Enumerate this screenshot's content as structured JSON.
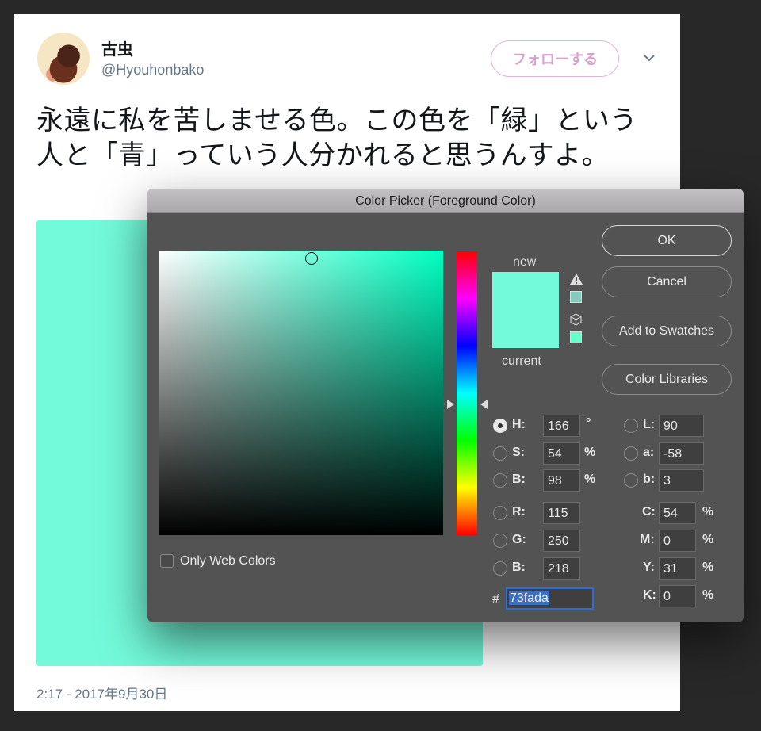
{
  "tweet": {
    "display_name": "古虫",
    "handle": "@Hyouhonbako",
    "follow_label": "フォローする",
    "text": "永遠に私を苦しませる色。この色を「緑」という人と「青」っていう人分かれると思うんすよ。",
    "media_color": "#73fada",
    "timestamp": "2:17 - 2017年9月30日",
    "icons": {
      "menu": "chevron-down-icon",
      "avatar": "avatar-image"
    }
  },
  "dialog": {
    "title": "Color Picker (Foreground Color)",
    "swatch_new_label": "new",
    "swatch_current_label": "current",
    "new_color": "#73fada",
    "current_color": "#73fada",
    "gamut_warning_color": "#86c9bd",
    "web_safe_color": "#66ffcc",
    "buttons": {
      "ok": "OK",
      "cancel": "Cancel",
      "add_swatches": "Add to Swatches",
      "color_libraries": "Color Libraries"
    },
    "only_web_colors_label": "Only Web Colors",
    "only_web_colors_checked": false,
    "hsb": [
      {
        "label": "H:",
        "value": "166",
        "unit": "°",
        "selected": true
      },
      {
        "label": "S:",
        "value": "54",
        "unit": "%",
        "selected": false
      },
      {
        "label": "B:",
        "value": "98",
        "unit": "%",
        "selected": false
      }
    ],
    "rgb": [
      {
        "label": "R:",
        "value": "115"
      },
      {
        "label": "G:",
        "value": "250"
      },
      {
        "label": "B:",
        "value": "218"
      }
    ],
    "lab": [
      {
        "label": "L:",
        "value": "90"
      },
      {
        "label": "a:",
        "value": "-58"
      },
      {
        "label": "b:",
        "value": "3"
      }
    ],
    "cmyk": [
      {
        "label": "C:",
        "value": "54",
        "unit": "%"
      },
      {
        "label": "M:",
        "value": "0",
        "unit": "%"
      },
      {
        "label": "Y:",
        "value": "31",
        "unit": "%"
      },
      {
        "label": "K:",
        "value": "0",
        "unit": "%"
      }
    ],
    "hex_prefix": "#",
    "hex_value": "73fada",
    "hue_degrees": 166
  }
}
